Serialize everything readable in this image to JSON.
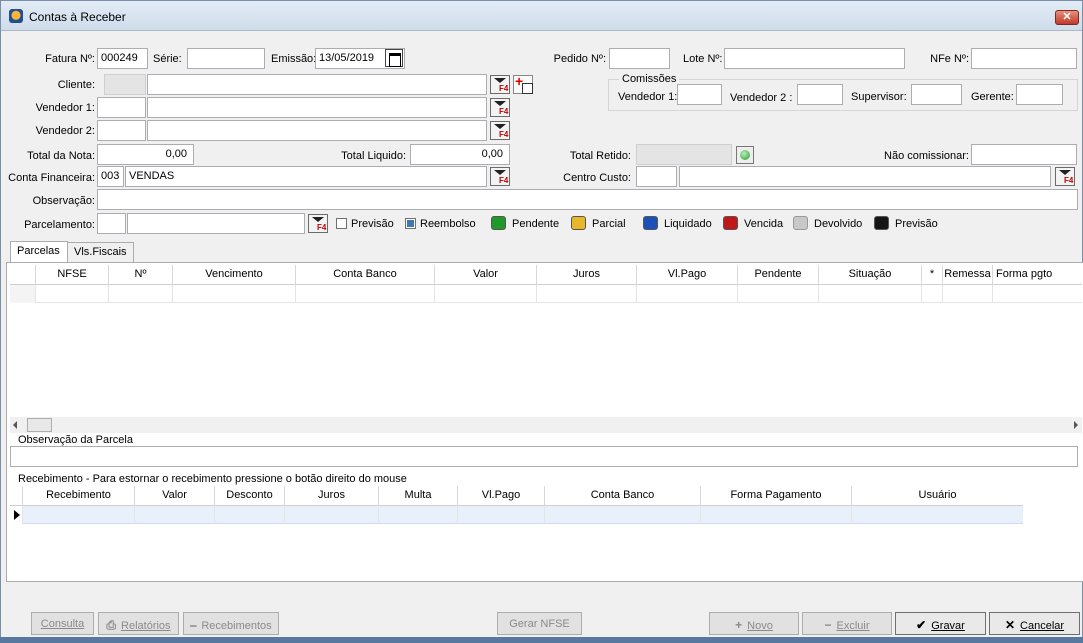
{
  "window": {
    "title": "Contas à Receber",
    "close_glyph": "✕"
  },
  "header": {
    "fatura_label": "Fatura Nº:",
    "fatura_value": "000249",
    "serie_label": "Série:",
    "serie_value": "",
    "emissao_label": "Emissão:",
    "emissao_value": "13/05/2019",
    "pedido_label": "Pedido Nº:",
    "pedido_value": "",
    "lote_label": "Lote Nº:",
    "lote_value": "",
    "nfe_label": "NFe Nº:",
    "nfe_value": "",
    "cliente_label": "Cliente:",
    "cliente_code": "",
    "cliente_name": "",
    "vendedor1_label": "Vendedor 1:",
    "vendedor1_code": "",
    "vendedor1_name": "",
    "vendedor2_label": "Vendedor 2:",
    "vendedor2_code": "",
    "vendedor2_name": "",
    "total_nota_label": "Total da Nota:",
    "total_nota_value": "0,00",
    "total_liquido_label": "Total Liquido:",
    "total_liquido_value": "0,00",
    "total_retido_label": "Total Retido:",
    "total_retido_value": "",
    "nao_comissionar_label": "Não comissionar:",
    "nao_comissionar_value": "",
    "conta_financeira_label": "Conta Financeira:",
    "conta_financeira_code": "003",
    "conta_financeira_name": "VENDAS",
    "centro_custo_label": "Centro Custo:",
    "centro_custo_code": "",
    "centro_custo_name": "",
    "observacao_label": "Observação:",
    "observacao_value": "",
    "parcelamento_label": "Parcelamento:",
    "parcelamento_code": "",
    "parcelamento_name": "",
    "f4_text": "F4"
  },
  "comissoes": {
    "title": "Comissões",
    "vendedor1_label": "Vendedor 1:",
    "vendedor2_label": "Vendedor 2 :",
    "supervisor_label": "Supervisor:",
    "gerente_label": "Gerente:"
  },
  "legend": {
    "previsao_check": {
      "label": "Previsão",
      "checked": false
    },
    "reembolso_check": {
      "label": "Reembolso",
      "checked": true
    },
    "items": [
      {
        "label": "Pendente",
        "color": "#1f9a2a"
      },
      {
        "label": "Parcial",
        "color": "#e8b82a"
      },
      {
        "label": "Liquidado",
        "color": "#1d4fb8"
      },
      {
        "label": "Vencida",
        "color": "#c01818"
      },
      {
        "label": "Devolvido",
        "color": "#c8c8c8"
      },
      {
        "label": "Previsão",
        "color": "#151515"
      }
    ]
  },
  "tabs": [
    {
      "label": "Parcelas",
      "active": true
    },
    {
      "label": "Vls.Fiscais",
      "active": false
    }
  ],
  "parcelas_grid": {
    "columns": [
      "NFSE",
      "Nº",
      "Vencimento",
      "Conta Banco",
      "Valor",
      "Juros",
      "Vl.Pago",
      "Pendente",
      "Situação",
      "*",
      "Remessa",
      "Forma pgto"
    ]
  },
  "observacao_parcela": {
    "label": "Observação da Parcela",
    "value": ""
  },
  "recebimento": {
    "label": "Recebimento - Para estornar o recebimento pressione o botão direito do mouse",
    "columns": [
      "Recebimento",
      "Valor",
      "Desconto",
      "Juros",
      "Multa",
      "Vl.Pago",
      "Conta Banco",
      "Forma Pagamento",
      "Usuário"
    ]
  },
  "buttons": {
    "consulta": "Consulta",
    "relatorios": "Relatórios",
    "recebimentos": "Recebimentos",
    "gerar_nfse": "Gerar NFSE",
    "novo": "Novo",
    "excluir": "Excluir",
    "gravar": "Gravar",
    "cancelar": "Cancelar"
  }
}
